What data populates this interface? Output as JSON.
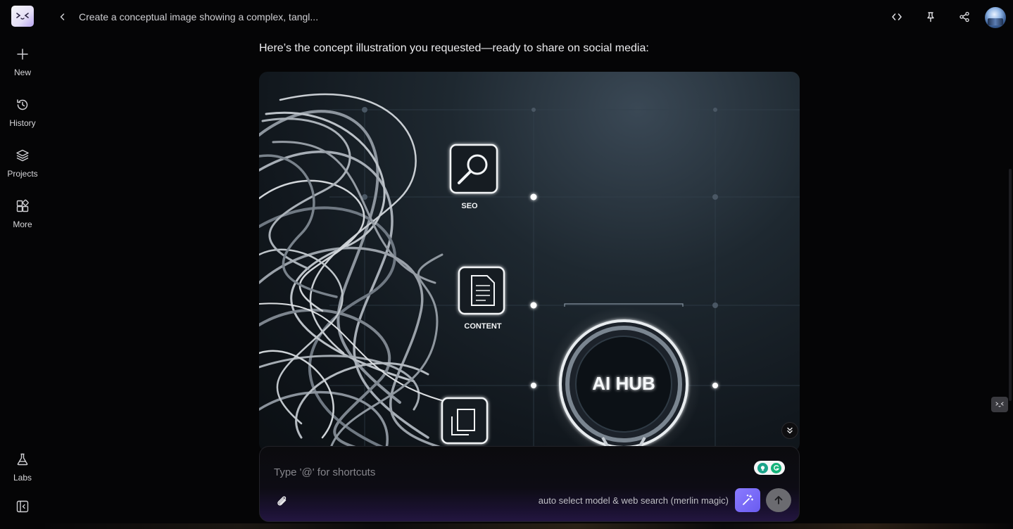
{
  "sidebar": {
    "items": [
      {
        "label": "New",
        "icon": "plus-icon"
      },
      {
        "label": "History",
        "icon": "history-icon"
      },
      {
        "label": "Projects",
        "icon": "layers-icon"
      },
      {
        "label": "More",
        "icon": "grid-plus-icon"
      }
    ],
    "labs": {
      "label": "Labs",
      "icon": "flask-icon"
    }
  },
  "header": {
    "title": "Create a conceptual image showing a complex, tangl..."
  },
  "message": {
    "text": "Here’s the concept illustration you requested—ready to share on social media:"
  },
  "image": {
    "labels": {
      "seo": "SEO",
      "content": "CONTENT",
      "hub": "AI HUB"
    }
  },
  "composer": {
    "placeholder": "Type '@' for shortcuts",
    "model_label": "auto select model & web search (merlin magic)"
  },
  "colors": {
    "accent": "#7b6cff",
    "background": "#050506"
  }
}
